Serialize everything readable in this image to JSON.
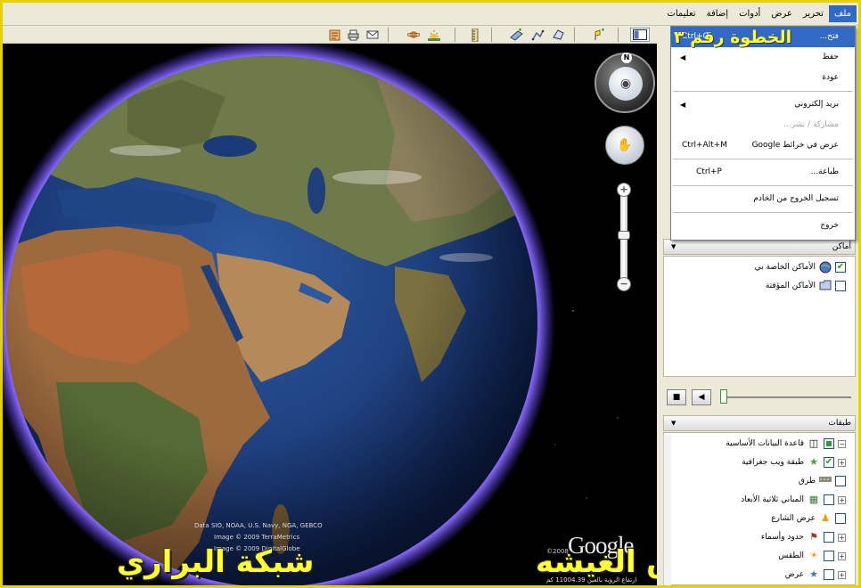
{
  "menu": {
    "items": [
      "ملف",
      "تحرير",
      "عرض",
      "أدوات",
      "إضافة",
      "تعليمات"
    ],
    "active_index": 0
  },
  "toolbar": {
    "icons": [
      "sidebar-toggle-icon",
      "placemark-icon",
      "polygon-icon",
      "path-icon",
      "image-overlay-icon",
      "ruler-icon",
      "sun-icon",
      "planet-icon",
      "email-icon",
      "print-icon",
      "maps-icon"
    ]
  },
  "file_menu": {
    "items": [
      {
        "label": "فتح...",
        "shortcut": "Ctrl+O",
        "highlighted": true
      },
      {
        "label": "حفظ",
        "submenu": true
      },
      {
        "label": "عودة"
      },
      {
        "separator": true
      },
      {
        "label": "بريد إلكتروني",
        "submenu": true
      },
      {
        "label": "مشاركة / نشر...",
        "disabled": true
      },
      {
        "label": "عرض في خرائط Google",
        "shortcut": "Ctrl+Alt+M"
      },
      {
        "separator": true
      },
      {
        "label": "طباعة...",
        "shortcut": "Ctrl+P"
      },
      {
        "separator": true
      },
      {
        "label": "تسجيل الخروج من الخادم"
      },
      {
        "separator": true
      },
      {
        "label": "خروج"
      }
    ]
  },
  "step_label": "الخطوة رقم ٣",
  "places": {
    "title": "أماكن",
    "items": [
      {
        "label": "الأماكن الخاصة بي",
        "checked": true
      },
      {
        "label": "الأماكن المؤقتة",
        "checked": false
      }
    ]
  },
  "layers": {
    "title": "طبقات",
    "items": [
      {
        "label": "قاعدة البيانات الأساسية",
        "state": "partial"
      },
      {
        "label": "طبقة ويب جغرافية",
        "state": "checked"
      },
      {
        "label": "طرق",
        "state": "unchecked"
      },
      {
        "label": "المباني ثلاثية الأبعاد",
        "state": "unchecked"
      },
      {
        "label": "عرض الشارع",
        "state": "unchecked"
      },
      {
        "label": "حدود وأسماء",
        "state": "unchecked"
      },
      {
        "label": "الطقس",
        "state": "unchecked"
      },
      {
        "label": "عرض",
        "state": "unchecked"
      }
    ]
  },
  "map": {
    "credits": [
      "Data SIO, NOAA, U.S. Navy, NGA, GEBCO",
      "Image © 2009 TerraMetrics",
      "Image © 2009 DigitalGlobe"
    ],
    "google_logo": "Google",
    "copyright_year": "©2008",
    "status_readout": "ارتفاع الرؤية بالعين 11004.39 كم",
    "compass_north": "N",
    "zoom_in": "+",
    "zoom_out": "−"
  },
  "watermarks": {
    "left": "شبكة البراري",
    "right": "بارق الغيشه"
  },
  "colors": {
    "menu_highlight": "#316ac5",
    "watermark": "#ffff33",
    "atmosphere": "#6a4dff",
    "ocean": "#1f3f7a"
  }
}
